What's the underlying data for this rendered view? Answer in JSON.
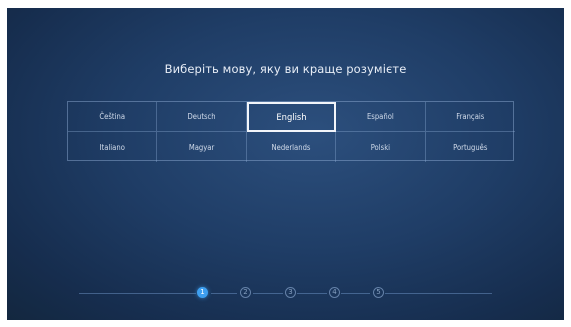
{
  "title": "Виберіть мову, яку ви краще розумієте",
  "languages": [
    [
      "Čeština",
      "Deutsch",
      "English",
      "Español",
      "Français"
    ],
    [
      "Italiano",
      "Magyar",
      "Nederlands",
      "Polski",
      "Português"
    ]
  ],
  "selected_language": "English",
  "steps": {
    "labels": [
      "1",
      "2",
      "3",
      "4",
      "5"
    ],
    "current": 1
  },
  "colors": {
    "background": "#1f3d66",
    "active_step": "#3e9ff0",
    "selection_border": "#f2f5fa"
  }
}
